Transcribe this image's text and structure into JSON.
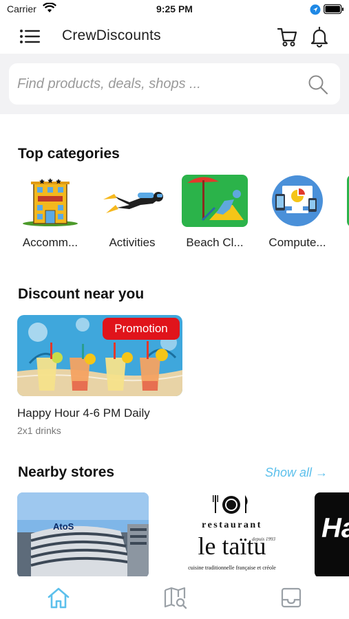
{
  "status_bar": {
    "carrier": "Carrier",
    "time": "9:25 PM"
  },
  "header": {
    "title": "CrewDiscounts"
  },
  "search": {
    "placeholder": "Find products, deals, shops ..."
  },
  "top_categories": {
    "title": "Top categories",
    "items": [
      {
        "label": "Accomm...",
        "icon": "hotel-icon"
      },
      {
        "label": "Activities",
        "icon": "diver-icon"
      },
      {
        "label": "Beach Cl...",
        "icon": "beach-chair-icon"
      },
      {
        "label": "Compute...",
        "icon": "computer-devices-icon"
      }
    ]
  },
  "discount_near_you": {
    "title": "Discount near you",
    "deals": [
      {
        "badge": "Promotion",
        "title": "Happy Hour 4-6 PM Daily",
        "subtitle": "2x1 drinks"
      }
    ]
  },
  "nearby_stores": {
    "title": "Nearby stores",
    "show_all": "Show all →",
    "stores": [
      {
        "logo_text": "AtoS"
      },
      {
        "logo_lines": [
          "restaurant",
          "le taïtu",
          "depuis 1993",
          "cuisine traditionnelle française et créole"
        ]
      },
      {
        "logo_text": "Ha"
      }
    ]
  },
  "tabbar": {
    "items": [
      "home-icon",
      "map-search-icon",
      "inbox-icon"
    ]
  },
  "colors": {
    "accent": "#5cc0ec",
    "promo": "#e0141b",
    "search_band": "#f2f2f4"
  }
}
